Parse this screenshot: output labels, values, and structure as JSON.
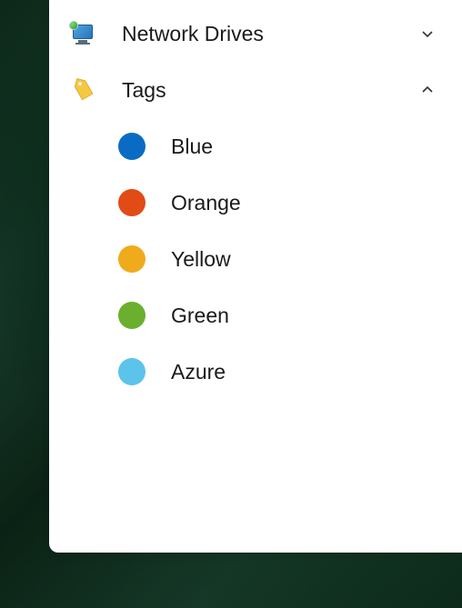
{
  "sidebar": {
    "network_drives": {
      "label": "Network Drives",
      "expanded": false
    },
    "tags": {
      "label": "Tags",
      "expanded": true,
      "items": [
        {
          "label": "Blue",
          "color": "#0a6bc5"
        },
        {
          "label": "Orange",
          "color": "#e04b16"
        },
        {
          "label": "Yellow",
          "color": "#f0ab1c"
        },
        {
          "label": "Green",
          "color": "#6aaf2e"
        },
        {
          "label": "Azure",
          "color": "#5cc3eb"
        }
      ]
    }
  }
}
